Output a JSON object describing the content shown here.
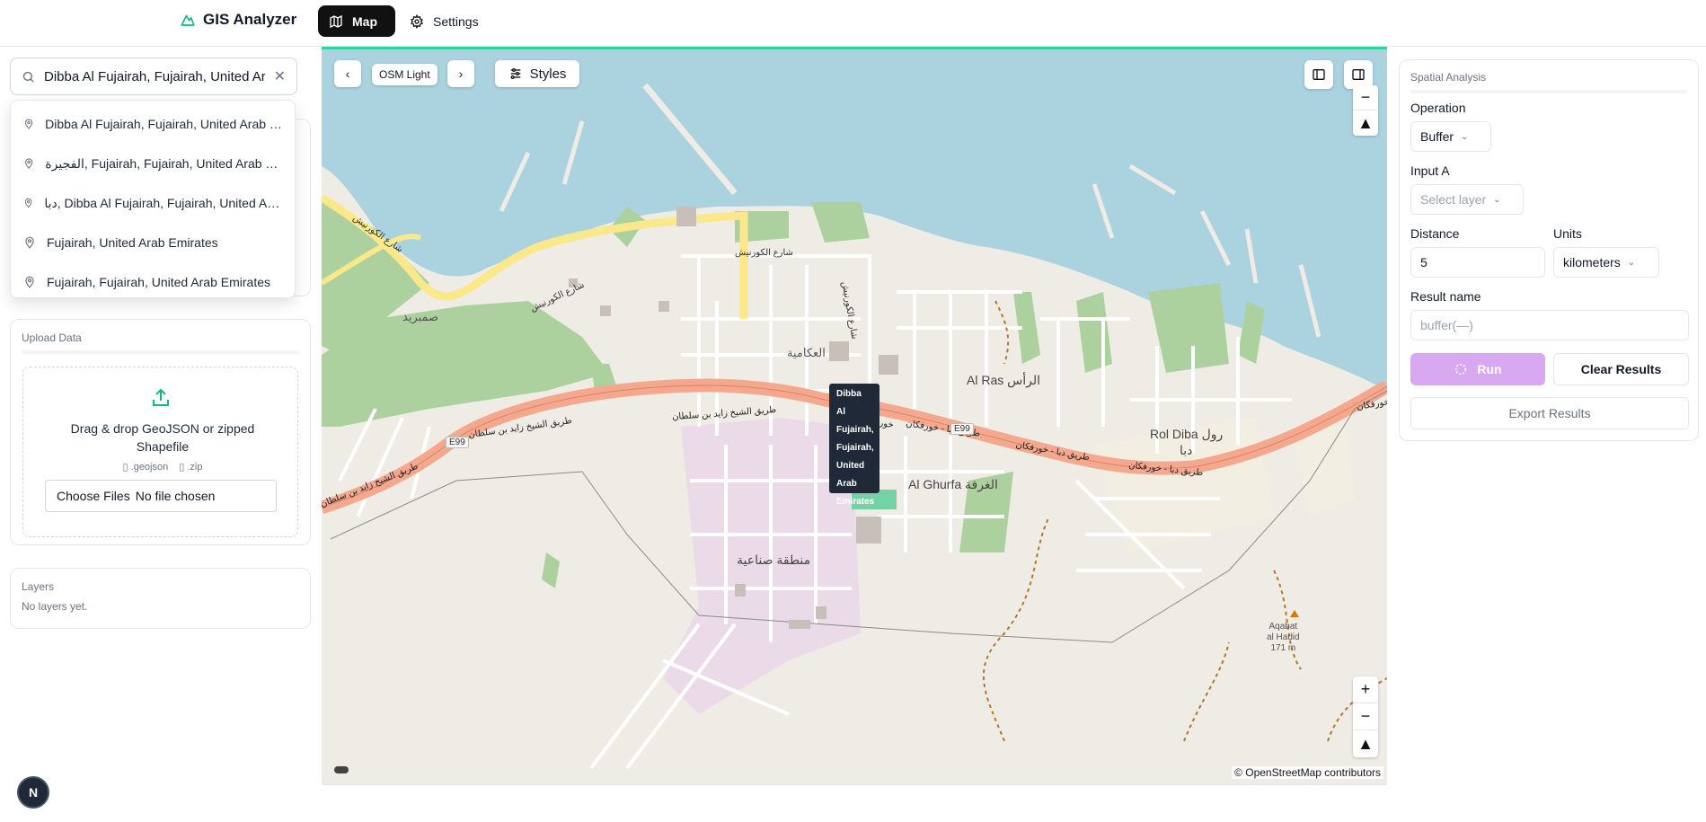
{
  "app": {
    "title": "GIS Analyzer",
    "accent": "#111111",
    "brand_color": "#10b981"
  },
  "nav": {
    "map_label": "Map",
    "settings_label": "Settings"
  },
  "search": {
    "value": "Dibba Al Fujairah, Fujairah, United Arab Emirates",
    "suggestions": [
      "Dibba Al Fujairah, Fujairah, United Arab Emirates",
      "الفجيرة, Fujairah, Fujairah, United Arab Emirates",
      "دبا, Dibba Al Fujairah, Fujairah, United Arab Emirates",
      "Fujairah, United Arab Emirates",
      "Fujairah, Fujairah, United Arab Emirates"
    ]
  },
  "upload": {
    "title": "Upload Data",
    "instructions": "Drag & drop GeoJSON or zipped Shapefile",
    "format1": ".geojson",
    "format2": ".zip",
    "file_button": "Choose Files",
    "file_status": "No file chosen"
  },
  "layers": {
    "title": "Layers",
    "empty": "No layers yet."
  },
  "user": {
    "avatar_initial": "N"
  },
  "map": {
    "style_name": "OSM Light",
    "styles_label": "Styles",
    "tooltip": [
      "Dibba Al",
      "Fujairah,",
      "Fujairah,",
      "United",
      "Arab",
      "Emirates"
    ],
    "attribution": "© OpenStreetMap contributors",
    "labels": {
      "corniche1": "شارع الكورنيش",
      "corniche2": "شارع الكورنيش",
      "corniche3": "شارع الكورنيش",
      "corniche4": "شارع الكورنيش",
      "sumraid": "صمبريد",
      "akamiya": "العكامية",
      "al_ras": "Al Ras الرأس",
      "rol_diba": "Rol Diba رول",
      "diba": "دبا",
      "al_ghurfa": "Al Ghurfa الغرفة",
      "industrial": "منطقة صناعية",
      "road_zayed1": "طريق الشيخ زايد بن سلطان",
      "road_zayed2": "طريق الشيخ زايد بن سلطان",
      "road_zayed3": "طريق الشيخ زايد بن سلطان",
      "road_diba1": "طريق دبا - خورفكان",
      "road_diba2": "طريق دبا - خورفكان",
      "road_diba3": "طريق دبا - خورفكان",
      "road_diba4": "خورفكان",
      "e99a": "E99",
      "e99b": "E99",
      "peak_name1": "Aqabat",
      "peak_name2": "al Hadid",
      "peak_elev": "171 m"
    },
    "colors": {
      "water": "#aad3df",
      "land": "#efece6",
      "green": "#add19e",
      "motorway": "#f4a98f",
      "highlight_road": "#fae88a",
      "industrial": "#ebdbe8"
    }
  },
  "analysis": {
    "title": "Spatial Analysis",
    "operation_label": "Operation",
    "operation_value": "Buffer",
    "input_a_label": "Input A",
    "input_a_placeholder": "Select layer",
    "distance_label": "Distance",
    "distance_value": "5",
    "units_label": "Units",
    "units_value": "kilometers",
    "result_name_label": "Result name",
    "result_name_placeholder": "buffer(—)",
    "run_label": "Run",
    "clear_label": "Clear Results",
    "export_label": "Export Results"
  }
}
